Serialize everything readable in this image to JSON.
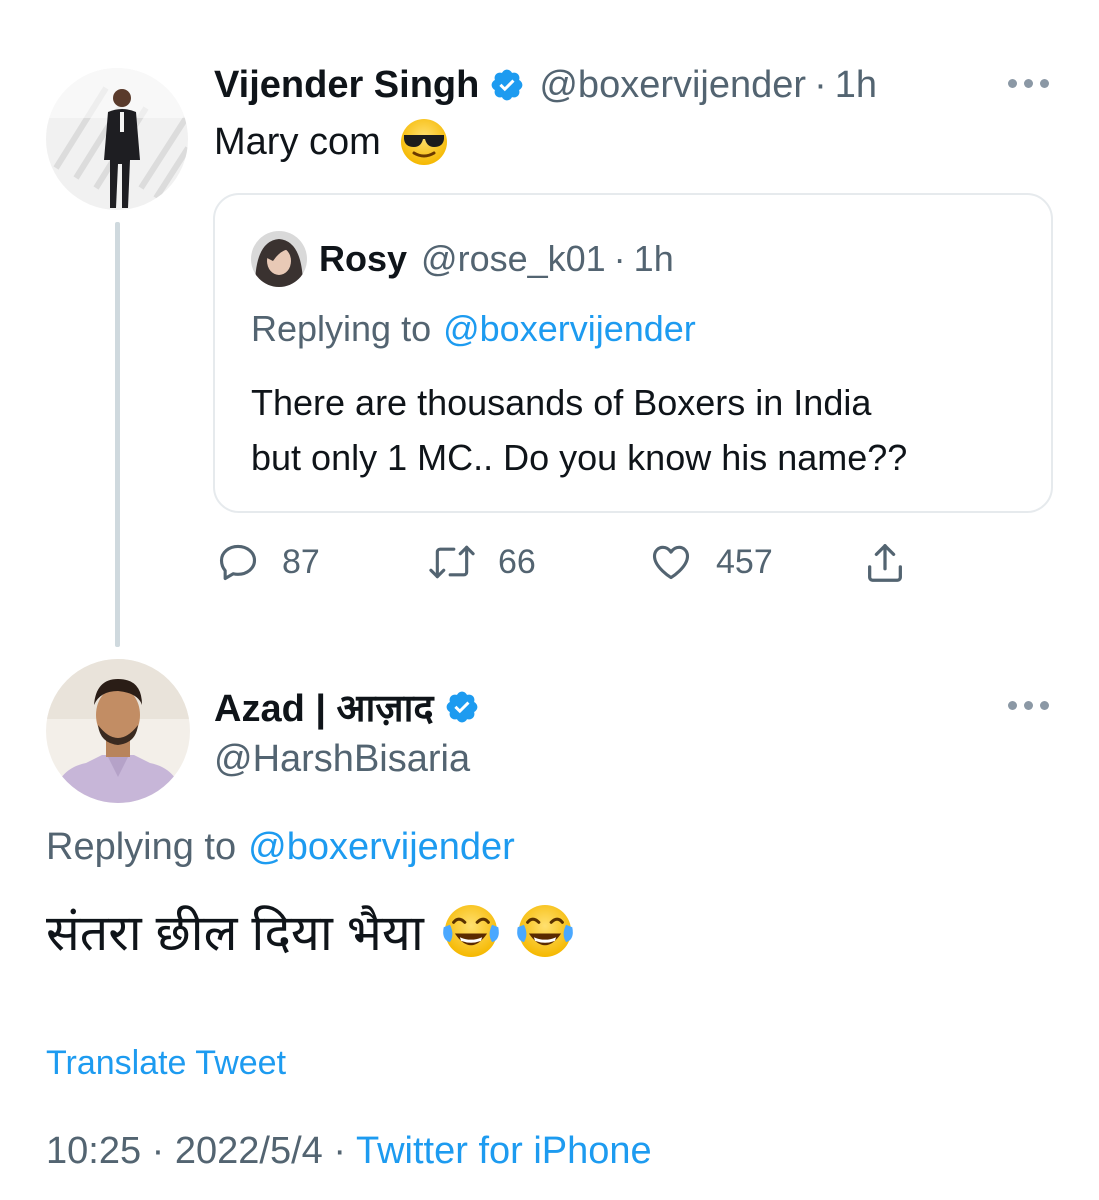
{
  "main_tweet": {
    "name": "Vijender Singh",
    "handle": "@boxervijender",
    "separator": "·",
    "time": "1h",
    "text": "Mary com",
    "emoji": "sunglasses-face"
  },
  "quoted_tweet": {
    "name": "Rosy",
    "handle": "@rose_k01",
    "separator": "·",
    "time": "1h",
    "replying_prefix": "Replying to",
    "replying_handle": "@boxervijender",
    "text_line1": "There are thousands of Boxers in India",
    "text_line2": "but only 1 MC.. Do you know his name??"
  },
  "actions": {
    "replies": "87",
    "retweets": "66",
    "likes": "457"
  },
  "reply_tweet": {
    "name": "Azad | आज़ाद",
    "handle": "@HarshBisaria",
    "replying_prefix": "Replying to",
    "replying_handle": "@boxervijender",
    "text": "संतरा छील दिया भैया",
    "emoji": "tears-of-joy-face",
    "translate": "Translate Tweet",
    "timestamp": "10:25 · 2022/5/4 ·",
    "source": "Twitter for iPhone"
  },
  "colors": {
    "accent": "#1d9bf0",
    "muted": "#536471",
    "border": "#e6eaed",
    "thread_line": "#cfd9de"
  }
}
